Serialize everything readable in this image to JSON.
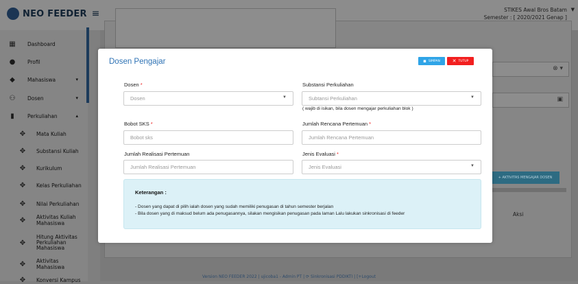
{
  "app": {
    "logo_text": "NEO FEEDER",
    "menu_icon": "hamburger-icon"
  },
  "user": {
    "institution": "STIKES Awal Bros Batam",
    "semester": "Semester : [ 2020/2021 Genap ]"
  },
  "sidebar": {
    "items": [
      {
        "label": "Dashboard",
        "icon": "dashboard-icon"
      },
      {
        "label": "Profil",
        "icon": "profile-icon"
      },
      {
        "label": "Mahasiswa",
        "icon": "graduation-cap-icon",
        "caret": "down"
      },
      {
        "label": "Dosen",
        "icon": "users-icon",
        "caret": "down"
      },
      {
        "label": "Perkuliahan",
        "icon": "book-icon",
        "caret": "up"
      },
      {
        "label": "Mata Kuliah",
        "icon": "move-icon"
      },
      {
        "label": "Substansi Kuliah",
        "icon": "move-icon"
      },
      {
        "label": "Kurikulum",
        "icon": "move-icon"
      },
      {
        "label": "Kelas Perkuliahan",
        "icon": "move-icon"
      },
      {
        "label": "Nilai Perkuliahan",
        "icon": "move-icon"
      },
      {
        "label": "Aktivitas Kuliah Mahasiswa",
        "icon": "move-icon"
      },
      {
        "label": "Hitung Aktivitas Perkuliahan Mahasiswa",
        "icon": "move-icon"
      },
      {
        "label": "Aktivitas Mahasiswa",
        "icon": "move-icon"
      },
      {
        "label": "Konversi Kampus",
        "icon": "move-icon"
      }
    ]
  },
  "background": {
    "add_button": "+ AKTIVITAS MENGAJAR DOSEN",
    "aksi_header": "Aksi"
  },
  "modal": {
    "title": "Dosen Pengajar",
    "save_label": "SIMPAN",
    "close_label": "TUTUP",
    "fields": {
      "dosen": {
        "label": "Dosen",
        "placeholder": "Dosen"
      },
      "substansi": {
        "label": "Substansi Perkuliahan",
        "placeholder": "Subtansi Perkuliahan",
        "hint": "( wajib di isikan, bila dosen mengajar perkuliahan blok )"
      },
      "bobot": {
        "label": "Bobot SKS",
        "placeholder": "Bobot sks"
      },
      "rencana": {
        "label": "Jumlah Rencana Pertemuan",
        "placeholder": "Jumlah Rencana Pertemuan"
      },
      "realisasi": {
        "label": "Jumlah Realisasi Pertemuan",
        "placeholder": "Jumlah Realisasi Pertemuan"
      },
      "evaluasi": {
        "label": "Jenis Evaluasi",
        "placeholder": "Jenis Evaluasi"
      }
    },
    "note": {
      "title": "Keterangan :",
      "line1": "- Dosen yang dapat di pilih ialah dosen yang sudah memiliki penugasan di tahun semester berjalan",
      "line2": "- Bila dosen yang di maksud belum ada penugasannya, silakan mengisikan penugasan pada laman Lalu lakukan sinkronisasi di feeder"
    }
  },
  "footer": {
    "text": "Version NEO FEEDER 2022 | ujicoba1 - Admin PT | ⟳ Sinkronisasi PDDIKTI | [+Logout"
  },
  "colors": {
    "title": "#2f73b5",
    "save": "#2fa4e7",
    "close": "#f21f1f",
    "required": "#e22222",
    "note_bg": "#dcf1f7"
  }
}
